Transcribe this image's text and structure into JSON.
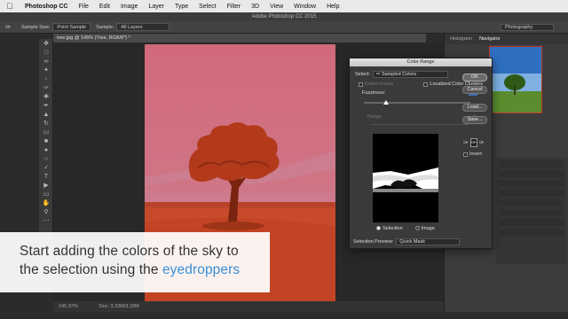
{
  "menubar": {
    "app_name": "Photoshop CC",
    "items": [
      "File",
      "Edit",
      "Image",
      "Layer",
      "Type",
      "Select",
      "Filter",
      "3D",
      "View",
      "Window",
      "Help"
    ]
  },
  "window_title": "Adobe Photoshop CC 2015",
  "options_bar": {
    "sample_size_label": "Sample Size:",
    "sample_size_value": "Point Sample",
    "sample_label": "Sample:",
    "sample_value": "All Layers",
    "workspace": "Photography"
  },
  "document_tab": "tree.jpg @ 145% (Tree, RGB/8*) *",
  "status": {
    "zoom": "145.37%",
    "doc": "Doc: 3.33M/3.33M"
  },
  "right_panel": {
    "tabs": [
      "Histogram",
      "Navigator"
    ],
    "active_tab": "Navigator"
  },
  "dialog": {
    "title": "Color Range",
    "select_label": "Select:",
    "select_value": "Sampled Colors",
    "detect_faces": "Detect Faces",
    "localized": "Localized Color Clusters",
    "fuzziness_label": "Fuzziness:",
    "fuzziness_value": "40",
    "range_label": "Range",
    "range_value": "%",
    "selection_radio": "Selection",
    "image_radio": "Image",
    "selection_preview_label": "Selection Preview:",
    "selection_preview_value": "Quick Mask",
    "buttons": {
      "ok": "OK",
      "cancel": "Cancel",
      "load": "Load...",
      "save": "Save..."
    },
    "invert": "Invert"
  },
  "caption": {
    "line1": "Start adding the colors of the sky to",
    "line2_prefix": "the selection using the ",
    "line2_highlight": "eyedroppers"
  },
  "colors": {
    "quick_mask_sky": "#cf6a7a",
    "quick_mask_field": "#c6452a",
    "tree": "#b33a1c",
    "highlight": "#3a8fd6"
  }
}
